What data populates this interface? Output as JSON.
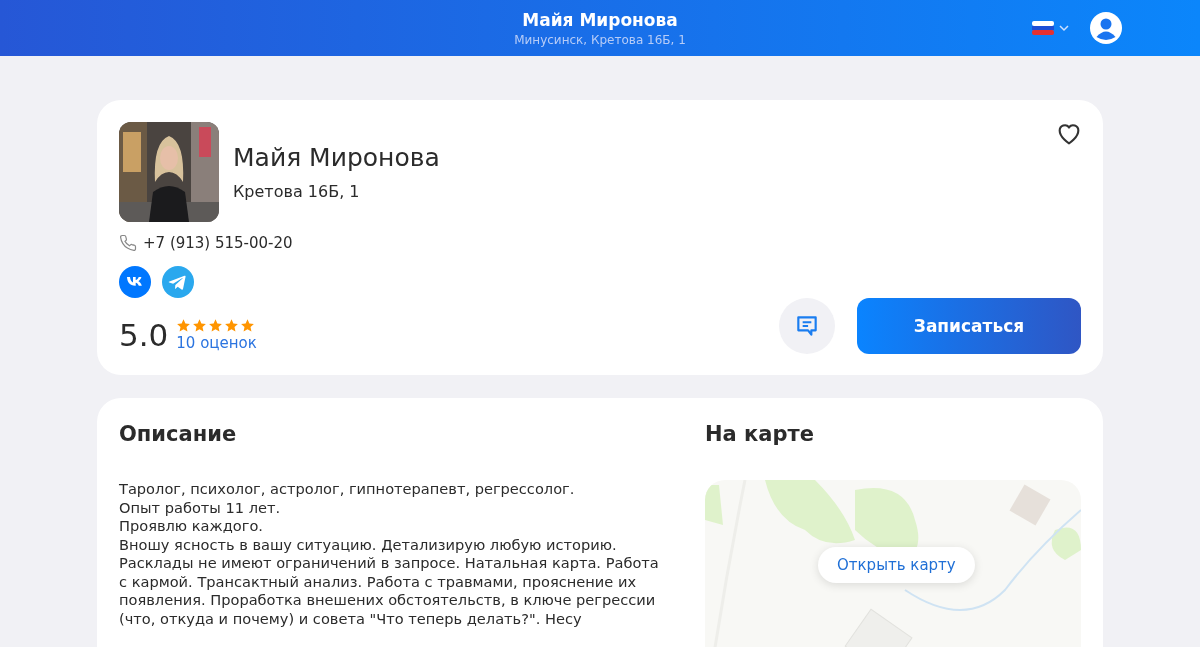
{
  "header": {
    "title": "Майя Миронова",
    "subtitle": "Минусинск, Кретова 16Б, 1"
  },
  "profile": {
    "name": "Майя Миронова",
    "address": "Кретова 16Б, 1",
    "favorite": false,
    "phone": "+7 (913) 515-00-20",
    "socials": [
      {
        "kind": "vk"
      },
      {
        "kind": "telegram"
      }
    ],
    "rating": {
      "score": "5.0",
      "stars": 5,
      "count": "10 оценок"
    },
    "book_button": "Записаться"
  },
  "description": {
    "title": "Описание",
    "lines": [
      "Таролог, психолог, астролог, гипнотерапевт, регрессолог.",
      "Опыт работы 11 лет.",
      "Проявлю каждого.",
      "Вношу ясность в вашу ситуацию. Детализирую любую историю. Расклады не имеют ограничений в запросе. Натальная карта. Работа с кармой. Трансактный анализ. Работа с травмами, прояснение их появления. Проработка внешених обстоятельств, в ключе регрессии (что, откуда и почему) и совета \"Что теперь делать?\". Несу"
    ]
  },
  "map": {
    "title": "На карте",
    "open_button": "Открыть карту"
  }
}
